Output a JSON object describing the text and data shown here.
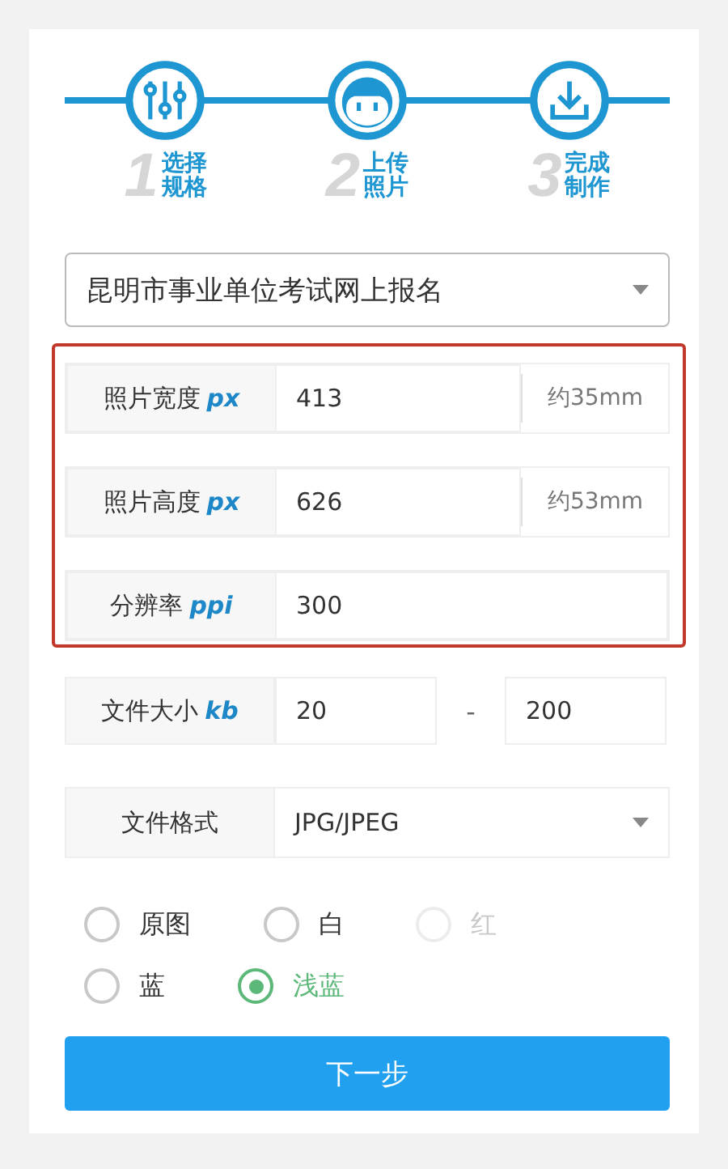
{
  "steps": [
    {
      "number": "1",
      "label": "选择规格"
    },
    {
      "number": "2",
      "label": "上传照片"
    },
    {
      "number": "3",
      "label": "完成制作"
    }
  ],
  "spec_select": {
    "value": "昆明市事业单位考试网上报名"
  },
  "highlighted_fields": [
    {
      "label": "照片宽度",
      "unit": "px",
      "value": "413",
      "note": "约35mm"
    },
    {
      "label": "照片高度",
      "unit": "px",
      "value": "626",
      "note": "约53mm"
    },
    {
      "label": "分辨率",
      "unit": "ppi",
      "value": "300"
    }
  ],
  "file_size": {
    "label": "文件大小",
    "unit": "kb",
    "min": "20",
    "separator": "-",
    "max": "200"
  },
  "file_format": {
    "label": "文件格式",
    "value": "JPG/JPEG"
  },
  "background_options": [
    {
      "label": "原图",
      "selected": false,
      "disabled": false
    },
    {
      "label": "白",
      "selected": false,
      "disabled": false
    },
    {
      "label": "红",
      "selected": false,
      "disabled": true
    },
    {
      "label": "蓝",
      "selected": false,
      "disabled": false
    },
    {
      "label": "浅蓝",
      "selected": true,
      "disabled": false
    }
  ],
  "next_button": "下一步"
}
